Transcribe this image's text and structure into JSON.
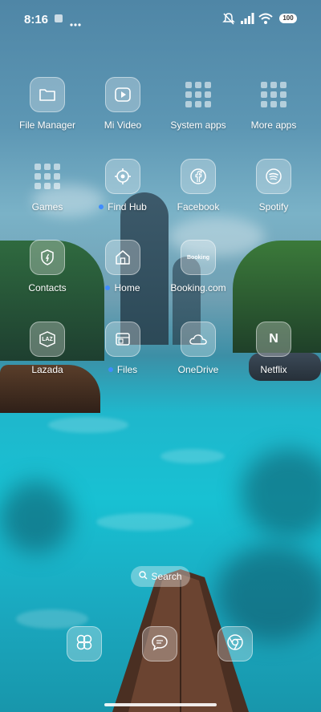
{
  "status": {
    "time": "8:16",
    "battery": "100",
    "icons": [
      "notification-app-icon",
      "more-dots-icon",
      "mute-icon",
      "signal-icon",
      "wifi-icon",
      "battery-icon"
    ]
  },
  "apps": [
    {
      "id": "file-manager",
      "label": "File Manager",
      "icon": "folder-icon",
      "dot": false
    },
    {
      "id": "mi-video",
      "label": "Mi Video",
      "icon": "play-icon",
      "dot": false
    },
    {
      "id": "system-apps",
      "label": "System apps",
      "icon": "folder-grid-icon",
      "dot": false
    },
    {
      "id": "more-apps",
      "label": "More apps",
      "icon": "folder-grid-icon",
      "dot": false
    },
    {
      "id": "games",
      "label": "Games",
      "icon": "folder-grid-icon",
      "dot": false
    },
    {
      "id": "find-hub",
      "label": "Find Hub",
      "icon": "location-target-icon",
      "dot": true
    },
    {
      "id": "facebook",
      "label": "Facebook",
      "icon": "facebook-icon",
      "dot": false
    },
    {
      "id": "spotify",
      "label": "Spotify",
      "icon": "spotify-icon",
      "dot": false
    },
    {
      "id": "contacts",
      "label": "Contacts",
      "icon": "contacts-icon",
      "dot": false
    },
    {
      "id": "home",
      "label": "Home",
      "icon": "house-icon",
      "dot": true
    },
    {
      "id": "booking",
      "label": "Booking.com",
      "icon": "booking-icon",
      "icon_text": "Booking",
      "dot": false
    },
    {
      "id": "lazada",
      "label": "Lazada",
      "icon": "lazada-icon",
      "icon_text": "LAZ",
      "dot": false
    },
    {
      "id": "files",
      "label": "Files",
      "icon": "files-icon",
      "dot": true
    },
    {
      "id": "onedrive",
      "label": "OneDrive",
      "icon": "cloud-icon",
      "dot": false
    },
    {
      "id": "netflix",
      "label": "Netflix",
      "icon": "netflix-icon",
      "icon_text": "N",
      "dot": false
    }
  ],
  "search": {
    "label": "Search"
  },
  "dock": [
    {
      "id": "dock-1",
      "icon": "dock-app-icon"
    },
    {
      "id": "dock-2",
      "icon": "chat-bubble-icon"
    },
    {
      "id": "dock-3",
      "icon": "chrome-icon"
    }
  ],
  "colors": {
    "accent_dot": "#3f8cff",
    "text": "#ffffff"
  }
}
